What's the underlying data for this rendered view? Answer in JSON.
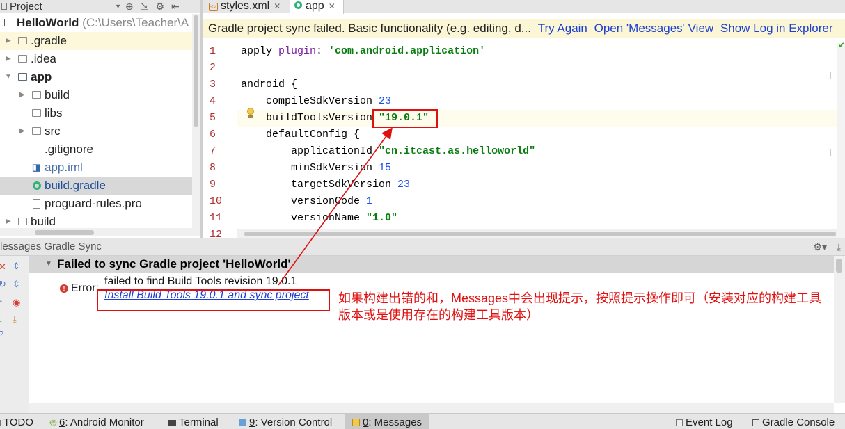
{
  "project_panel": {
    "title": "Project",
    "root": {
      "name": "HelloWorld",
      "path": "(C:\\Users\\Teacher\\A"
    },
    "items": [
      {
        "label": ".gradle"
      },
      {
        "label": ".idea"
      },
      {
        "label": "app"
      },
      {
        "label": "build"
      },
      {
        "label": "libs"
      },
      {
        "label": "src"
      },
      {
        "label": ".gitignore"
      },
      {
        "label": "app.iml"
      },
      {
        "label": "build.gradle"
      },
      {
        "label": "proguard-rules.pro"
      },
      {
        "label": "build"
      }
    ]
  },
  "editor": {
    "tabs": [
      {
        "label": "styles.xml",
        "icon": "xml-file-icon"
      },
      {
        "label": "app",
        "icon": "gradle-icon"
      }
    ],
    "notification": {
      "text": "Gradle project sync failed. Basic functionality (e.g. editing, d...",
      "links": [
        "Try Again",
        "Open 'Messages' View",
        "Show Log in Explorer"
      ]
    },
    "line_numbers": [
      "1",
      "2",
      "3",
      "4",
      "5",
      "6",
      "7",
      "8",
      "9",
      "10",
      "11",
      "12"
    ],
    "code": {
      "l1_kw": "apply ",
      "l1_id": "plugin",
      "l1_sep": ": ",
      "l1_str": "'com.android.application'",
      "l3": "android {",
      "l4_kw": "    compileSdkVersion ",
      "l4_num": "23",
      "l5_kw": "    buildToolsVersion ",
      "l5_str": "\"19.0.1\"",
      "l6": "    defaultConfig {",
      "l7_kw": "        applicationId ",
      "l7_str": "\"cn.itcast.as.helloworld\"",
      "l8_kw": "        minSdkVersion ",
      "l8_num": "15",
      "l9_kw": "        targetSdkVersion ",
      "l9_num": "23",
      "l10_kw": "        versionCode ",
      "l10_num": "1",
      "l11_kw": "        versionName ",
      "l11_str": "\"1.0\"",
      "l12": "    }"
    }
  },
  "messages": {
    "header": "lessages Gradle Sync",
    "fail_title": "Failed to sync Gradle project 'HelloWorld'",
    "error_label": "Error:",
    "error_text": "failed to find Build Tools revision 19.0.1",
    "error_link": "Install Build Tools 19.0.1 and sync project",
    "annotation": "如果构建出错的和，Messages中会出现提示，按照提示操作即可（安装对应的构建工具版本或是使用存在的构建工具版本）"
  },
  "statusbar": {
    "todo": "TODO",
    "android_monitor_num": "6",
    "android_monitor": ": Android Monitor",
    "terminal": "Terminal",
    "vc_num": "9",
    "version_control": ": Version Control",
    "msg_num": "0",
    "messages": ": Messages",
    "event_log": "Event Log",
    "gradle_console": "Gradle Console"
  },
  "colors": {
    "annotation_red": "#e01010",
    "link_blue": "#1d3fd4",
    "notification_bg": "#fbf7d6"
  }
}
